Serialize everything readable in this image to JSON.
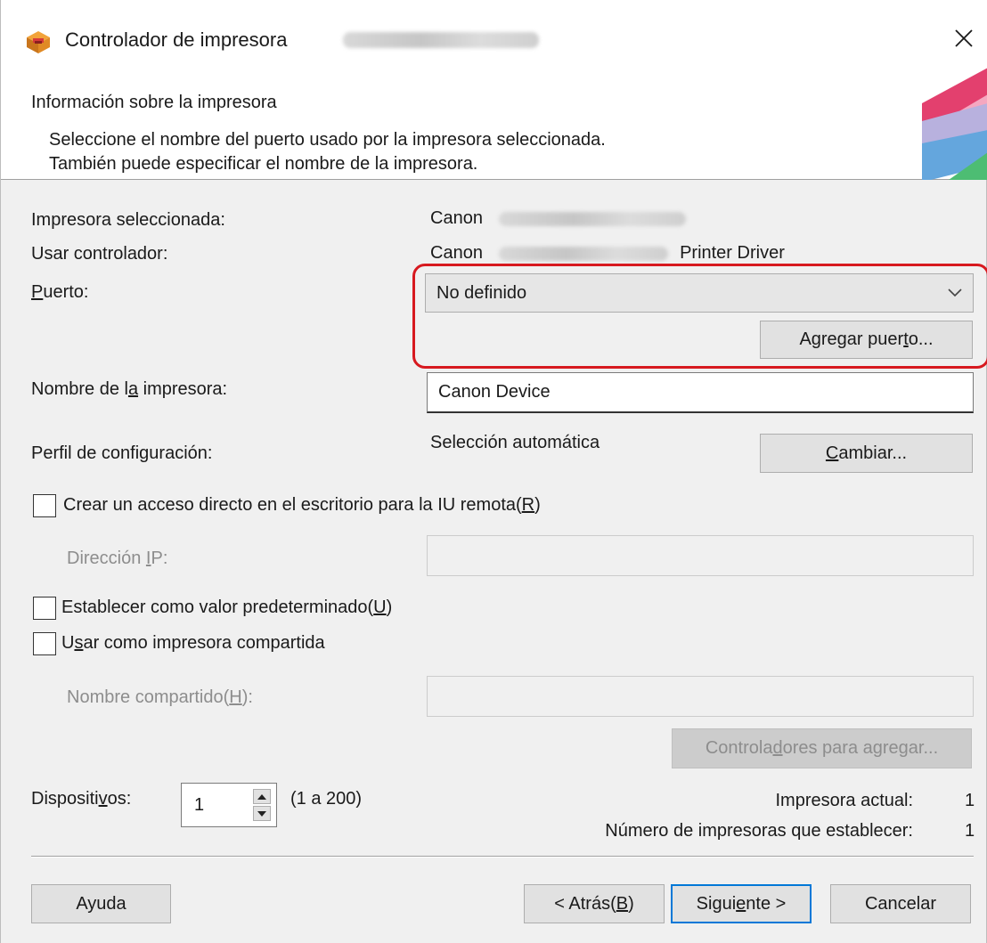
{
  "window": {
    "title": "Controlador de impresora",
    "close_glyph": "✕",
    "app_icon": "printer-driver-icon"
  },
  "header": {
    "title": "Información sobre la impresora",
    "desc_line1": "Seleccione el nombre del puerto usado por la impresora seleccionada.",
    "desc_line2": "También puede especificar el nombre de la impresora."
  },
  "info": {
    "selected_printer_label": "Impresora seleccionada:",
    "selected_printer_value": "Canon",
    "driver_label": "Usar controlador:",
    "driver_value_prefix": "Canon",
    "driver_value_suffix": "Printer Driver"
  },
  "port": {
    "label_accel": "P",
    "label_rest": "uerto:",
    "selected": "No definido",
    "add_button_pre": "Agregar puer",
    "add_button_accel": "t",
    "add_button_post": "o..."
  },
  "printer_name": {
    "label_pre": "Nombre de l",
    "label_accel": "a",
    "label_post": " impresora:",
    "value": "Canon Device"
  },
  "profile": {
    "label": "Perfil de configuración:",
    "value": "Selección automática",
    "button_accel": "C",
    "button_rest": "ambiar..."
  },
  "remote_ui": {
    "checkbox_label_main": "Crear un acceso directo en el escritorio para la IU remota(",
    "checkbox_label_accel": "R",
    "checkbox_label_end": ")",
    "checked": false,
    "ip_label_pre": "Dirección ",
    "ip_label_accel": "I",
    "ip_label_post": "P:",
    "ip_value": ""
  },
  "default_printer": {
    "label_main": "Establecer como valor predeterminado(",
    "label_accel": "U",
    "label_end": ")",
    "checked": false
  },
  "shared": {
    "label_pre": "U",
    "label_accel": "s",
    "label_post": "ar como impresora compartida",
    "checked": false,
    "name_label_pre": "Nombre compartido(",
    "name_label_accel": "H",
    "name_label_post": "):",
    "name_value": "",
    "drivers_button_pre": "Controla",
    "drivers_button_accel": "d",
    "drivers_button_post": "ores para agregar..."
  },
  "devices": {
    "label_pre": "Dispositi",
    "label_accel": "v",
    "label_post": "os:",
    "value": "1",
    "range": "(1 a 200)",
    "current_label": "Impresora actual:",
    "current_value": "1",
    "count_label": "Número de impresoras que establecer:",
    "count_value": "1"
  },
  "footer": {
    "help": "Ayuda",
    "back_pre": "< Atrás(",
    "back_accel": "B",
    "back_post": ")",
    "next_pre": "Sigui",
    "next_accel": "e",
    "next_post": "nte >",
    "cancel": "Cancelar"
  }
}
